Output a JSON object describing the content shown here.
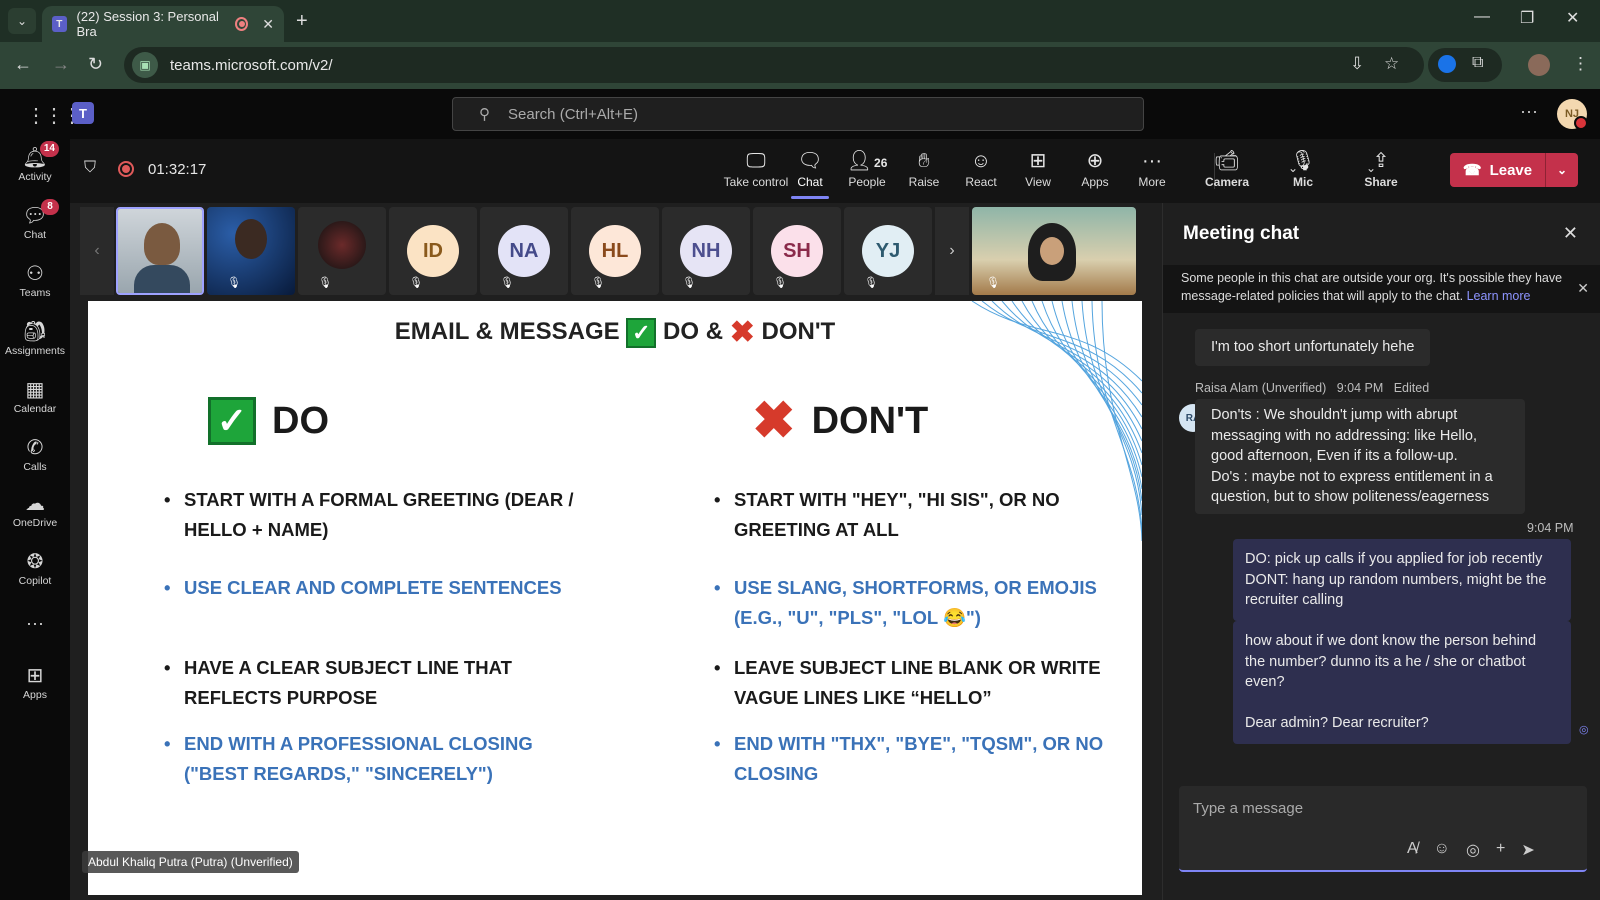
{
  "browser": {
    "tab_title": "(22) Session 3: Personal Bra",
    "url": "teams.microsoft.com/v2/"
  },
  "teams": {
    "search_placeholder": "Search (Ctrl+Alt+E)",
    "user_initials": "NJ"
  },
  "rail": [
    {
      "label": "Activity",
      "icon": "bell-icon",
      "badge": "14"
    },
    {
      "label": "Chat",
      "icon": "chat-icon",
      "badge": "8"
    },
    {
      "label": "Teams",
      "icon": "teams-icon",
      "badge": ""
    },
    {
      "label": "Assignments",
      "icon": "assignments-icon",
      "badge": ""
    },
    {
      "label": "Calendar",
      "icon": "calendar-icon",
      "badge": ""
    },
    {
      "label": "Calls",
      "icon": "phone-icon",
      "badge": ""
    },
    {
      "label": "OneDrive",
      "icon": "cloud-icon",
      "badge": ""
    },
    {
      "label": "Copilot",
      "icon": "copilot-icon",
      "badge": ""
    },
    {
      "label": "Apps",
      "icon": "plus-box-icon",
      "badge": ""
    }
  ],
  "meeting": {
    "timer": "01:32:17",
    "people_count": "26",
    "buttons": {
      "take_control": "Take control",
      "chat": "Chat",
      "people": "People",
      "raise": "Raise",
      "react": "React",
      "view": "View",
      "apps": "Apps",
      "more": "More",
      "camera": "Camera",
      "mic": "Mic",
      "share": "Share",
      "leave": "Leave"
    }
  },
  "participants": [
    {
      "initials": "ID",
      "bg": "#fbe3c4",
      "fg": "#8a5a1c"
    },
    {
      "initials": "NA",
      "bg": "#e3e3f7",
      "fg": "#444a8a"
    },
    {
      "initials": "HL",
      "bg": "#fde7d8",
      "fg": "#8a4a1c"
    },
    {
      "initials": "NH",
      "bg": "#e6e4f5",
      "fg": "#4d4f8f"
    },
    {
      "initials": "SH",
      "bg": "#fbe0ea",
      "fg": "#8a2a4a"
    },
    {
      "initials": "YJ",
      "bg": "#e1eef4",
      "fg": "#2e5a6f"
    }
  ],
  "slide": {
    "title_pre": "EMAIL & MESSAGE",
    "title_mid": "DO  &",
    "title_post": "DON'T",
    "do_heading": "DO",
    "dont_heading": "DON'T",
    "do_items": [
      {
        "text": "START WITH A FORMAL GREETING (DEAR / HELLO + NAME)",
        "color": "black"
      },
      {
        "text": "USE CLEAR AND COMPLETE SENTENCES",
        "color": "blue"
      },
      {
        "text": "HAVE A CLEAR SUBJECT LINE THAT REFLECTS PURPOSE",
        "color": "black"
      },
      {
        "text": "END WITH A PROFESSIONAL CLOSING (\"BEST REGARDS,\" \"SINCERELY\")",
        "color": "blue"
      }
    ],
    "dont_items": [
      {
        "text": "START WITH \"HEY\", \"HI SIS\", OR NO GREETING AT ALL",
        "color": "black"
      },
      {
        "text": "USE SLANG, SHORTFORMS, OR EMOJIS (E.G., \"U\", \"PLS\", \"LOL 😂\")",
        "color": "blue"
      },
      {
        "text": "LEAVE SUBJECT LINE BLANK OR WRITE VAGUE LINES LIKE “HELLO”",
        "color": "black"
      },
      {
        "text": "END WITH \"THX\", \"BYE\", \"TQSM\", OR NO CLOSING",
        "color": "blue"
      }
    ],
    "presenter_tag": "Abdul Khaliq Putra (Putra) (Unverified)"
  },
  "chat": {
    "title": "Meeting chat",
    "notice": "Some people in this chat are outside your org. It's possible they have message-related policies that will apply to the chat.",
    "notice_link": "Learn more",
    "msg1": "I'm too short unfortunately hehe",
    "msg2_sender": "Raisa Alam (Unverified)",
    "msg2_time": "9:04 PM",
    "msg2_edited": "Edited",
    "msg2_avatar": "RA",
    "msg2_text": "Don'ts : We shouldn't jump with abrupt messaging with no addressing: like Hello, good afternoon, Even if its a follow-up.\nDo's : maybe not to express entitlement in a question, but to show politeness/eagerness",
    "my_time": "9:04 PM",
    "my_msg1": "DO: pick up calls if you applied for job recently\nDONT: hang up random numbers, might be the recruiter calling",
    "my_msg2": "how about if we dont know the person behind the number? dunno its a he / she or chatbot even?\n\nDear admin? Dear recruiter?",
    "composer_placeholder": "Type a message"
  }
}
